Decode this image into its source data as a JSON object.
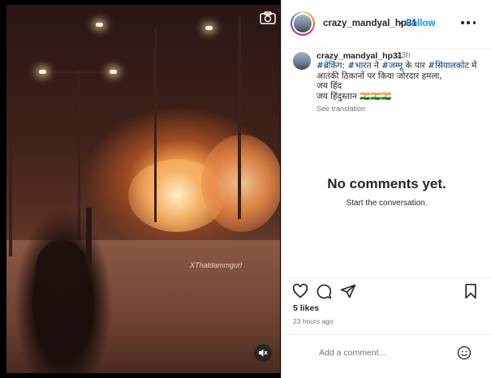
{
  "media": {
    "watermark": "XThatdammgurl",
    "camera_icon": "camera-icon",
    "mute_icon": "muted-speaker-icon"
  },
  "header": {
    "username": "crazy_mandyal_hp31",
    "separator": "•",
    "follow_label": "Follow",
    "more_icon": "more-options-icon"
  },
  "caption": {
    "username": "crazy_mandyal_hp31",
    "time": "23h",
    "line1_parts": [
      "#ब्रेकिंग",
      ": ",
      "#भारत",
      " ने ",
      "#जम्मू",
      " के पार ",
      "#सियालकोट",
      " में"
    ],
    "line2": "आतंकी ठिकानों पर किया जोरदार हमला,",
    "line3": "जय हिंद",
    "line4": "जय हिंदुस्तान 🇮🇳🇮🇳🇮🇳",
    "see_translation": "See translation"
  },
  "comments": {
    "empty_title": "No comments yet.",
    "empty_subtitle": "Start the conversation."
  },
  "actions": {
    "likes": "5 likes",
    "time_ago": "23 hours ago"
  },
  "comment_box": {
    "placeholder": "Add a comment...",
    "emoji_icon": "emoji-icon"
  },
  "colors": {
    "link_blue": "#0095f6",
    "hashtag": "#00376b",
    "text": "#262626",
    "muted": "#737373"
  }
}
